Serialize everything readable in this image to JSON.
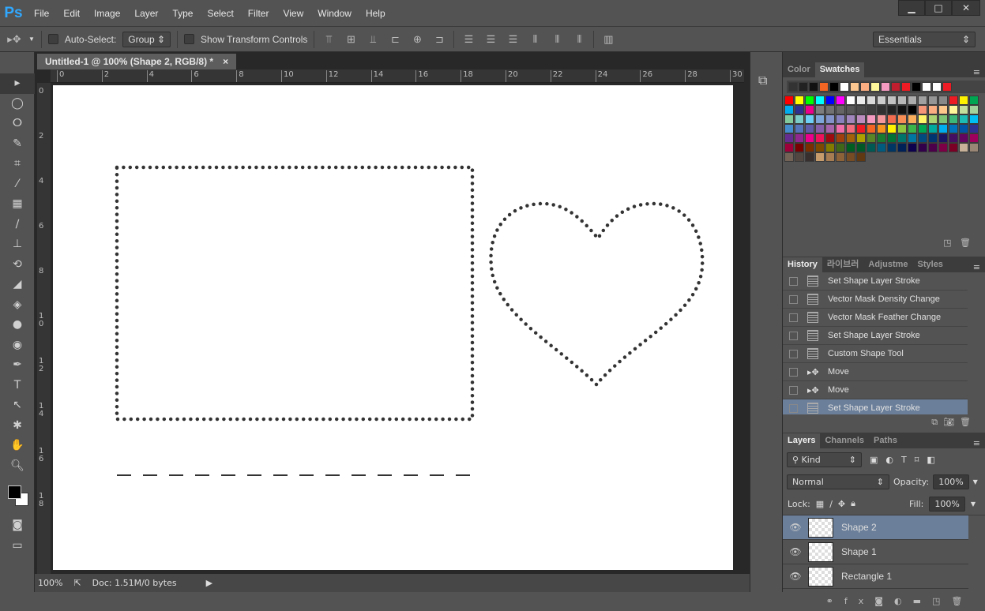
{
  "app": {
    "logo": "Ps",
    "menu": [
      "File",
      "Edit",
      "Image",
      "Layer",
      "Type",
      "Select",
      "Filter",
      "View",
      "Window",
      "Help"
    ],
    "window_controls": [
      "minimize",
      "maximize",
      "close"
    ]
  },
  "options": {
    "auto_select_label": "Auto-Select:",
    "auto_select_value": "Group",
    "transform_label": "Show Transform Controls",
    "workspace": "Essentials"
  },
  "document": {
    "tab_title": "Untitled-1 @ 100% (Shape 2, RGB/8) *",
    "ruler_top": [
      "0",
      "2",
      "4",
      "6",
      "8",
      "10",
      "12",
      "14",
      "16",
      "18",
      "20",
      "22",
      "24",
      "26",
      "28",
      "30"
    ],
    "ruler_left": [
      "0",
      "2",
      "4",
      "6",
      "8",
      "10",
      "12",
      "14",
      "16",
      "18"
    ],
    "zoom": "100%",
    "doc_info": "Doc: 1.51M/0 bytes"
  },
  "swatches": {
    "tabs": [
      "Color",
      "Swatches"
    ],
    "recent": [
      "#333333",
      "#222222",
      "#111111",
      "#f26522",
      "#000000",
      "#ffffff",
      "#fbc68f",
      "#f9ad81",
      "#fff799",
      "#f49ac1",
      "#be1e2d",
      "#ed1c24",
      "#000000",
      "#ffffff",
      "#ffffff",
      "#ed1c24"
    ],
    "rows": [
      [
        "#ff0000",
        "#ffff00",
        "#00ff00",
        "#00ffff",
        "#0000ff",
        "#ff00ff",
        "#ffffff",
        "#ebebeb",
        "#d9d9d9",
        "#cccccc",
        "#c2c2c2",
        "#b7b7b7",
        "#acacac",
        "#a0a0a0",
        "#959595",
        "#898989",
        "#ed1c24",
        "#fff200",
        "#00a651"
      ],
      [
        "#00aeef",
        "#2e3192",
        "#ec008c",
        "#7d7d7d",
        "#717171",
        "#656565",
        "#585858",
        "#4b4b4b",
        "#3e3e3e",
        "#303030",
        "#222222",
        "#111111",
        "#000000",
        "#f69679",
        "#f9ad81",
        "#fdc68a",
        "#fff799",
        "#c4df9b",
        "#a3d39c"
      ],
      [
        "#82ca9c",
        "#7accc8",
        "#6dcff6",
        "#7da7d9",
        "#8393ca",
        "#8781bd",
        "#a186be",
        "#bd8cbf",
        "#f49ac1",
        "#f5989d",
        "#f26c4f",
        "#f68e56",
        "#fbaf5d",
        "#fff568",
        "#acd373",
        "#7cc576",
        "#3cb878",
        "#1cbbb4",
        "#00bff3"
      ],
      [
        "#448ccb",
        "#5574b9",
        "#605ca8",
        "#8560a8",
        "#a864a8",
        "#f06eaa",
        "#f26d7d",
        "#ed1c24",
        "#f26522",
        "#f7941d",
        "#fff200",
        "#8dc63f",
        "#39b54a",
        "#00a651",
        "#00a99d",
        "#00aeef",
        "#0072bc",
        "#0054a6",
        "#2e3192"
      ],
      [
        "#662d91",
        "#92278f",
        "#ec008c",
        "#ed145b",
        "#9e0b0f",
        "#a0410d",
        "#a36209",
        "#aba000",
        "#598527",
        "#197b30",
        "#007236",
        "#00746b",
        "#0076a3",
        "#004a80",
        "#003471",
        "#1b1464",
        "#440e62",
        "#630460",
        "#9e005d"
      ],
      [
        "#9e0039",
        "#790000",
        "#7b2e00",
        "#7d4900",
        "#827b00",
        "#406618",
        "#005e20",
        "#005826",
        "#005952",
        "#005b7f",
        "#003663",
        "#002157",
        "#0d004c",
        "#32004b",
        "#4b0049",
        "#7b0046",
        "#7a0026",
        "#c7b299",
        "#998675"
      ],
      [
        "#736357",
        "#534741",
        "#362f2d",
        "#c69c6d",
        "#a67c52",
        "#8c6239",
        "#754c24",
        "#603913"
      ]
    ]
  },
  "history": {
    "tabs": [
      "History",
      "라이브러",
      "Adjustme",
      "Styles"
    ],
    "items": [
      "Set Shape Layer Stroke",
      "Vector Mask Density Change",
      "Vector Mask Feather Change",
      "Set Shape Layer Stroke",
      "Custom Shape Tool",
      "Move",
      "Move",
      "Set Shape Layer Stroke"
    ],
    "item_icons": [
      "history-state",
      "history-state",
      "history-state",
      "history-state",
      "history-state",
      "move",
      "move",
      "history-state"
    ],
    "selected_index": 7
  },
  "layers": {
    "tabs": [
      "Layers",
      "Channels",
      "Paths"
    ],
    "filter": "Kind",
    "blend_mode": "Normal",
    "opacity_label": "Opacity:",
    "opacity": "100%",
    "lock_label": "Lock:",
    "fill_label": "Fill:",
    "fill": "100%",
    "items": [
      "Shape 2",
      "Shape 1",
      "Rectangle 1"
    ],
    "selected_index": 0
  },
  "colors": {
    "selection": "#6b7f9a",
    "panel": "#535353",
    "pasteboard": "#282828",
    "stroke": "#333333"
  }
}
